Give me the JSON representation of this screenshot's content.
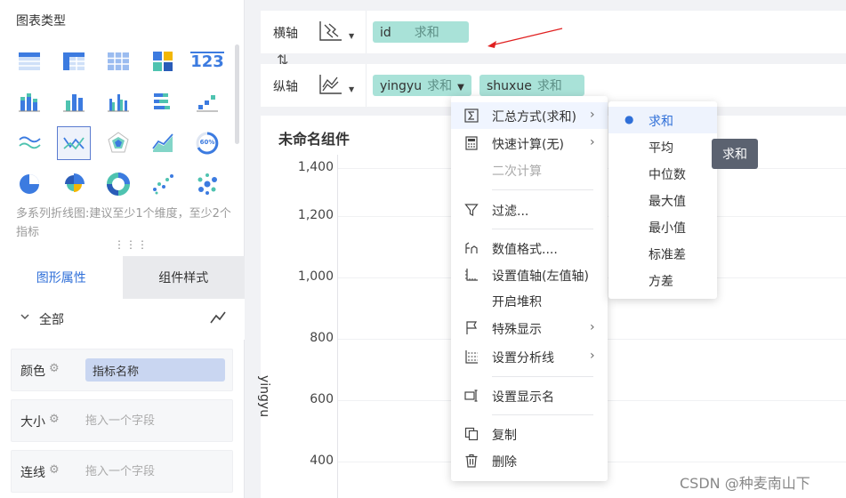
{
  "left_panel": {
    "section_title": "图表类型",
    "chart_types": [
      {
        "icon": "table-icon"
      },
      {
        "icon": "cross-table-icon"
      },
      {
        "icon": "detail-table-icon"
      },
      {
        "icon": "heatmap-table-icon"
      },
      {
        "icon": "number-card-icon"
      },
      {
        "icon": "stacked-bar-icon"
      },
      {
        "icon": "bar-icon"
      },
      {
        "icon": "grouped-bar-icon"
      },
      {
        "icon": "horizontal-bar-icon"
      },
      {
        "icon": "waterfall-icon"
      },
      {
        "icon": "multi-line-icon"
      },
      {
        "icon": "line-icon"
      },
      {
        "icon": "radar-icon"
      },
      {
        "icon": "area-icon"
      },
      {
        "icon": "gauge-icon"
      },
      {
        "icon": "pie-icon"
      },
      {
        "icon": "rose-pie-icon"
      },
      {
        "icon": "donut-icon"
      },
      {
        "icon": "scatter-icon"
      },
      {
        "icon": "bubble-icon"
      }
    ],
    "number_card_text": "123",
    "gauge_text": "60%",
    "hint": "多系列折线图:建议至少1个维度，至少2个指标",
    "tabs": [
      "图形属性",
      "组件样式"
    ],
    "all_label": "全部",
    "props": [
      {
        "label": "颜色",
        "value": "指标名称",
        "filled": true
      },
      {
        "label": "大小",
        "value": "拖入一个字段",
        "filled": false
      },
      {
        "label": "连线",
        "value": "拖入一个字段",
        "filled": false
      }
    ]
  },
  "shelves": {
    "x_label": "横轴",
    "y_label": "纵轴",
    "x_tags": [
      {
        "name": "id",
        "agg": "求和"
      }
    ],
    "y_tags": [
      {
        "name": "yingyu",
        "agg": "求和"
      },
      {
        "name": "shuxue",
        "agg": "求和"
      }
    ],
    "swap_icon": "⇅"
  },
  "component": {
    "title": "未命名组件",
    "y_axis_name": "yingyu",
    "ticks": [
      "1,400",
      "1,200",
      "1,000",
      "800",
      "600",
      "400"
    ]
  },
  "menu": {
    "items": [
      {
        "icon": "sigma-icon",
        "label": "汇总方式(求和)",
        "arrow": true,
        "hover": true
      },
      {
        "icon": "calculator-icon",
        "label": "快速计算(无)",
        "arrow": true
      },
      {
        "icon": "",
        "label": "二次计算",
        "disabled": true
      },
      {
        "icon": "filter-icon",
        "label": "过滤..."
      },
      {
        "icon": "number-format-icon",
        "label": "数值格式...."
      },
      {
        "icon": "value-axis-icon",
        "label": "设置值轴(左值轴)"
      },
      {
        "icon": "",
        "label": "开启堆积"
      },
      {
        "icon": "flag-icon",
        "label": "特殊显示",
        "arrow": true
      },
      {
        "icon": "analysis-line-icon",
        "label": "设置分析线",
        "arrow": true
      },
      {
        "icon": "display-name-icon",
        "label": "设置显示名"
      },
      {
        "icon": "copy-icon",
        "label": "复制"
      },
      {
        "icon": "delete-icon",
        "label": "删除"
      }
    ]
  },
  "submenu": {
    "items": [
      "求和",
      "平均",
      "中位数",
      "最大值",
      "最小值",
      "标准差",
      "方差"
    ],
    "selected": 0
  },
  "tooltip": "求和",
  "watermark": "CSDN @种麦南山下",
  "colors": {
    "accent": "#2f6fd8",
    "tag_bg": "#a9e2d8",
    "pill_bg": "#c9d6f1",
    "arrow": "#e02020"
  }
}
